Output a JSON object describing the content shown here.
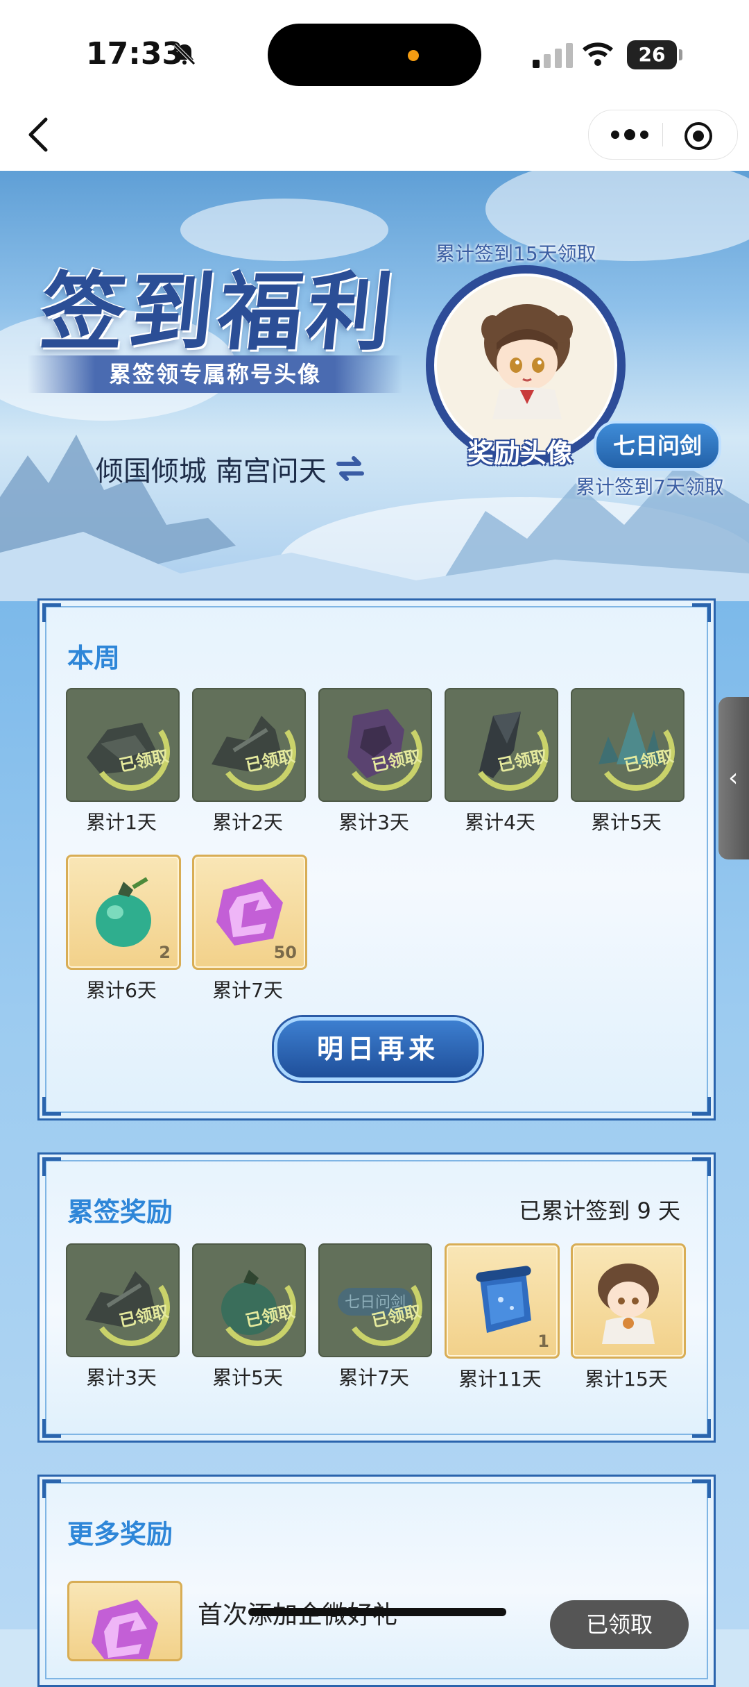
{
  "status_bar": {
    "time": "17:33",
    "battery": "26"
  },
  "banner": {
    "title": "签到福利",
    "subtitle": "累签领专属称号头像",
    "couple_names": "倾国倾城 南宫问天",
    "avatar_top_note": "累计签到15天领取",
    "avatar_label": "奖励头像",
    "title_badge": "七日问剑",
    "avatar_bottom_note": "累计签到7天领取"
  },
  "weekly": {
    "title": "本周",
    "claimed_stamp": "已领取",
    "items": [
      {
        "label": "累计1天",
        "state": "claimed",
        "icon": "rubble-icon"
      },
      {
        "label": "累计2天",
        "state": "claimed",
        "icon": "broken-sword-icon"
      },
      {
        "label": "累计3天",
        "state": "claimed",
        "icon": "purple-gem-icon"
      },
      {
        "label": "累计4天",
        "state": "claimed",
        "icon": "dark-crystal-icon"
      },
      {
        "label": "累计5天",
        "state": "claimed",
        "icon": "green-crystal-icon"
      },
      {
        "label": "累计6天",
        "state": "available",
        "icon": "jade-pouch-icon",
        "qty": "2"
      },
      {
        "label": "累计7天",
        "state": "available",
        "icon": "purple-rune-icon",
        "qty": "50"
      }
    ],
    "button": "明日再来"
  },
  "cumulative": {
    "title": "累签奖励",
    "progress": "已累计签到 9 天",
    "items": [
      {
        "label": "累计3天",
        "state": "claimed",
        "icon": "broken-sword-icon"
      },
      {
        "label": "累计5天",
        "state": "claimed",
        "icon": "jade-pouch-icon"
      },
      {
        "label": "累计7天",
        "state": "claimed",
        "icon": "title-plaque-icon",
        "plaque": "七日问剑"
      },
      {
        "label": "累计11天",
        "state": "available",
        "icon": "scroll-icon",
        "qty": "1"
      },
      {
        "label": "累计15天",
        "state": "available",
        "icon": "avatar-girl-icon"
      }
    ]
  },
  "more": {
    "title": "更多奖励",
    "item_name": "首次添加企微好礼",
    "button": "已领取"
  },
  "colors": {
    "panel_border": "#2a64ad",
    "panel_title": "#2e86d8",
    "claimed_tile": "#62705a",
    "gold_tile": "#f2d18a"
  }
}
